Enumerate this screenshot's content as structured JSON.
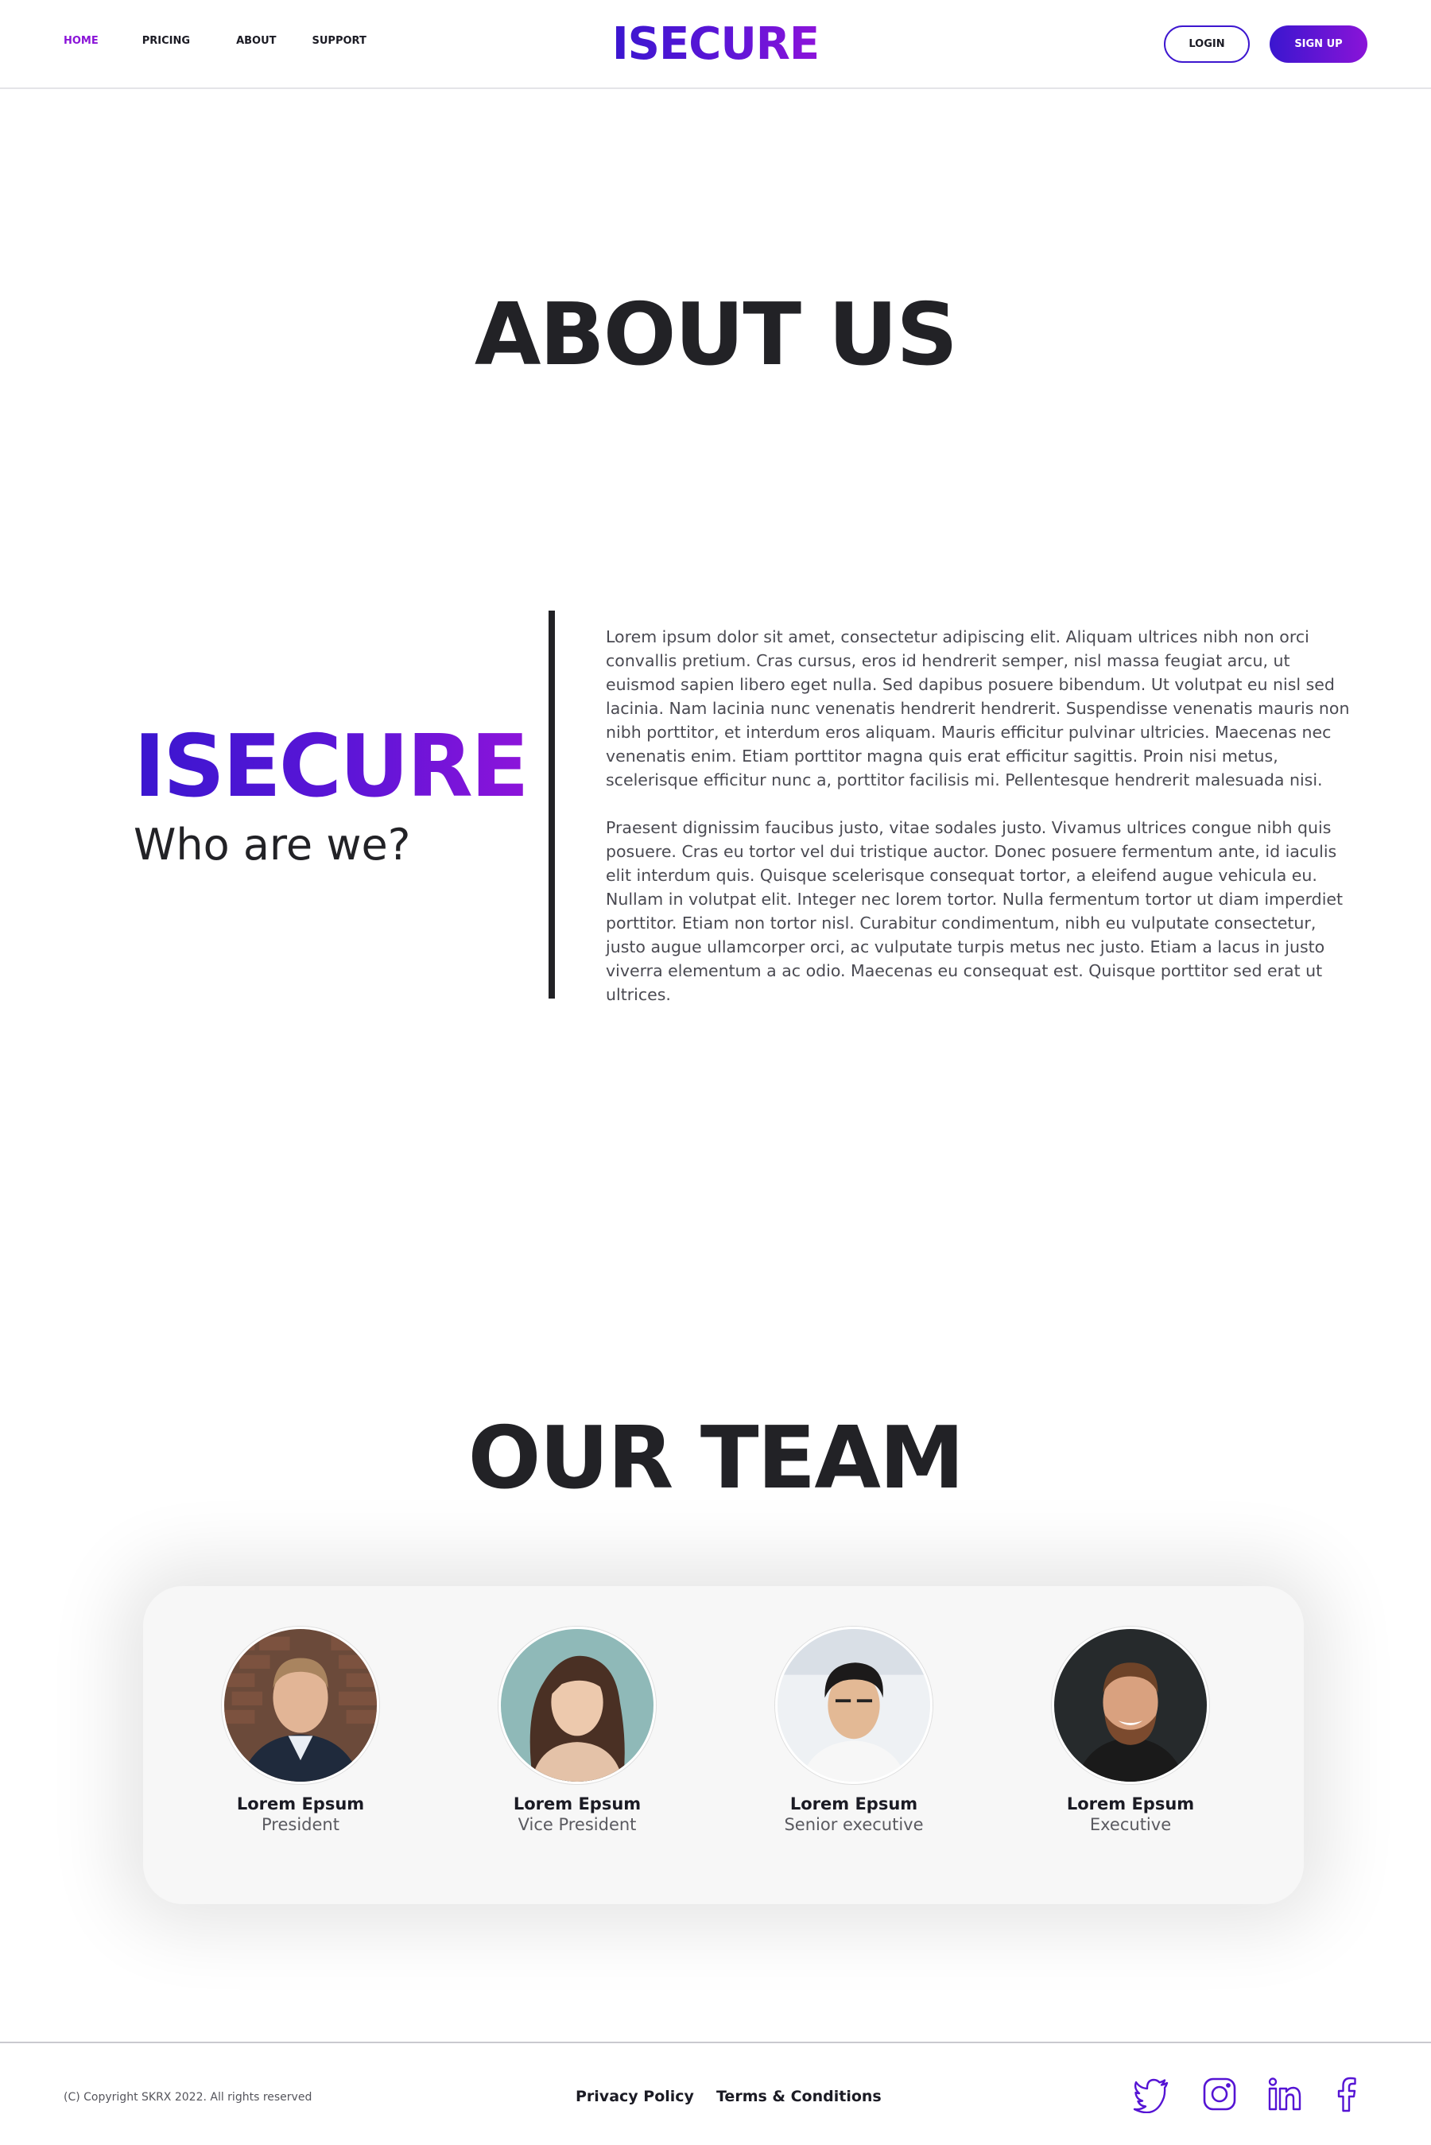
{
  "header": {
    "nav": [
      {
        "label": "HOME",
        "active": true
      },
      {
        "label": "PRICING",
        "active": false
      },
      {
        "label": "ABOUT",
        "active": false
      },
      {
        "label": "SUPPORT",
        "active": false
      }
    ],
    "logo": "ISECURE",
    "login_label": "LOGIN",
    "signup_label": "SIGN UP"
  },
  "about": {
    "title": "ABOUT US",
    "brand": "ISECURE",
    "tagline": "Who are we?",
    "paragraphs": [
      "Lorem ipsum dolor sit amet, consectetur adipiscing elit. Aliquam ultrices nibh non orci convallis pretium. Cras cursus, eros id hendrerit semper, nisl massa feugiat arcu, ut euismod sapien libero eget nulla. Sed dapibus posuere bibendum. Ut volutpat eu nisl sed lacinia. Nam lacinia nunc venenatis hendrerit hendrerit. Suspendisse venenatis mauris non nibh porttitor, et interdum eros aliquam. Mauris efficitur pulvinar ultricies. Maecenas nec venenatis enim. Etiam porttitor magna quis erat efficitur sagittis. Proin nisi metus, scelerisque efficitur nunc a, porttitor facilisis mi. Pellentesque hendrerit malesuada nisi.",
      "Praesent dignissim faucibus justo, vitae sodales justo. Vivamus ultrices congue nibh quis posuere. Cras eu tortor vel dui tristique auctor. Donec posuere fermentum ante, id iaculis elit interdum quis. Quisque scelerisque consequat tortor, a eleifend augue vehicula eu. Nullam in volutpat elit. Integer nec lorem tortor. Nulla fermentum tortor ut diam imperdiet porttitor. Etiam non tortor nisl. Curabitur condimentum, nibh eu vulputate consectetur, justo augue ullamcorper orci, ac vulputate turpis metus nec justo. Etiam a lacus in justo viverra elementum a ac odio. Maecenas eu consequat est. Quisque porttitor sed erat ut ultrices."
    ]
  },
  "team": {
    "title": "OUR TEAM",
    "members": [
      {
        "name": "Lorem Epsum",
        "role": "President"
      },
      {
        "name": "Lorem Epsum",
        "role": "Vice President"
      },
      {
        "name": "Lorem Epsum",
        "role": "Senior executive"
      },
      {
        "name": "Lorem Epsum",
        "role": "Executive"
      }
    ]
  },
  "footer": {
    "copyright": "(C) Copyright SKRX 2022. All rights reserved",
    "links": [
      "Privacy Policy",
      "Terms & Conditions"
    ],
    "social_icons": [
      "twitter-icon",
      "instagram-icon",
      "linkedin-icon",
      "facebook-icon"
    ]
  },
  "colors": {
    "accent_start": "#3a16cf",
    "accent_end": "#8a14d8",
    "text_dark": "#222226"
  }
}
